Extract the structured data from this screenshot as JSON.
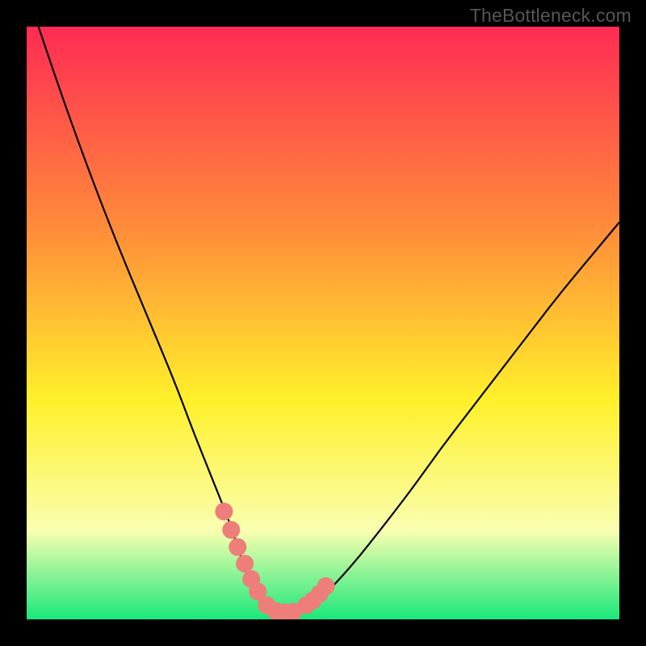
{
  "watermark": "TheBottleneck.com",
  "colors": {
    "page_bg": "#000000",
    "gradient_top": "#ff2b54",
    "gradient_mid1": "#ff8c3a",
    "gradient_mid2": "#fff02a",
    "gradient_low": "#faffb0",
    "gradient_bottom": "#19e87a",
    "curve": "#000000",
    "marker": "#ed7e79",
    "watermark": "#565656"
  },
  "chart_data": {
    "type": "line",
    "title": "",
    "xlabel": "",
    "ylabel": "",
    "xlim": [
      0,
      100
    ],
    "ylim": [
      0,
      100
    ],
    "series": [
      {
        "name": "bottleneck-curve",
        "x": [
          2,
          5,
          10,
          15,
          20,
          25,
          28,
          30,
          32,
          34,
          35,
          36,
          37,
          38,
          39,
          40,
          41,
          42,
          43,
          44,
          46,
          48,
          50,
          55,
          60,
          65,
          70,
          75,
          80,
          85,
          90,
          95,
          100
        ],
        "y": [
          100,
          91,
          77,
          64,
          52,
          40,
          32,
          27,
          22,
          17,
          14,
          11,
          8,
          5.5,
          3.7,
          2.4,
          1.6,
          1.2,
          1.0,
          1.0,
          1.2,
          2.1,
          3.8,
          9.2,
          15.5,
          22,
          29,
          35.5,
          42,
          48.5,
          55,
          61,
          67
        ]
      }
    ],
    "markers": {
      "name": "highlight-dots",
      "x": [
        33.3,
        34.5,
        35.6,
        36.8,
        37.9,
        39.0,
        40.5,
        42.0,
        43.5,
        45.0,
        47.2,
        48.3,
        49.4,
        50.5
      ],
      "y": [
        18.2,
        15.1,
        12.2,
        9.4,
        6.8,
        4.7,
        2.4,
        1.4,
        1.2,
        1.3,
        2.4,
        3.2,
        4.3,
        5.6
      ]
    }
  }
}
